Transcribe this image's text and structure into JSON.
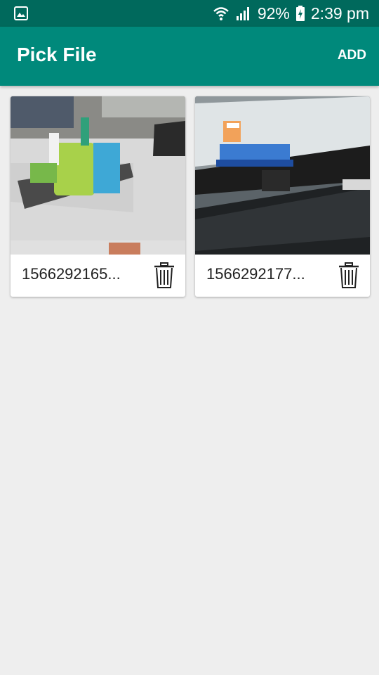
{
  "status_bar": {
    "battery": "92%",
    "time": "2:39 pm",
    "icons": [
      "gallery-notification-icon",
      "wifi-icon",
      "signal-icon",
      "battery-charging-icon"
    ]
  },
  "app_bar": {
    "title": "Pick File",
    "add_label": "ADD"
  },
  "files": [
    {
      "name": "1566292165...",
      "thumbnail": "photo of desk with colorful pen holder",
      "delete_icon": "trash-icon"
    },
    {
      "name": "1566292177...",
      "thumbnail": "photo of computer monitor and keyboard",
      "delete_icon": "trash-icon"
    }
  ],
  "colors": {
    "status_bar": "#00695c",
    "app_bar": "#00897b",
    "background": "#eeeeee"
  }
}
